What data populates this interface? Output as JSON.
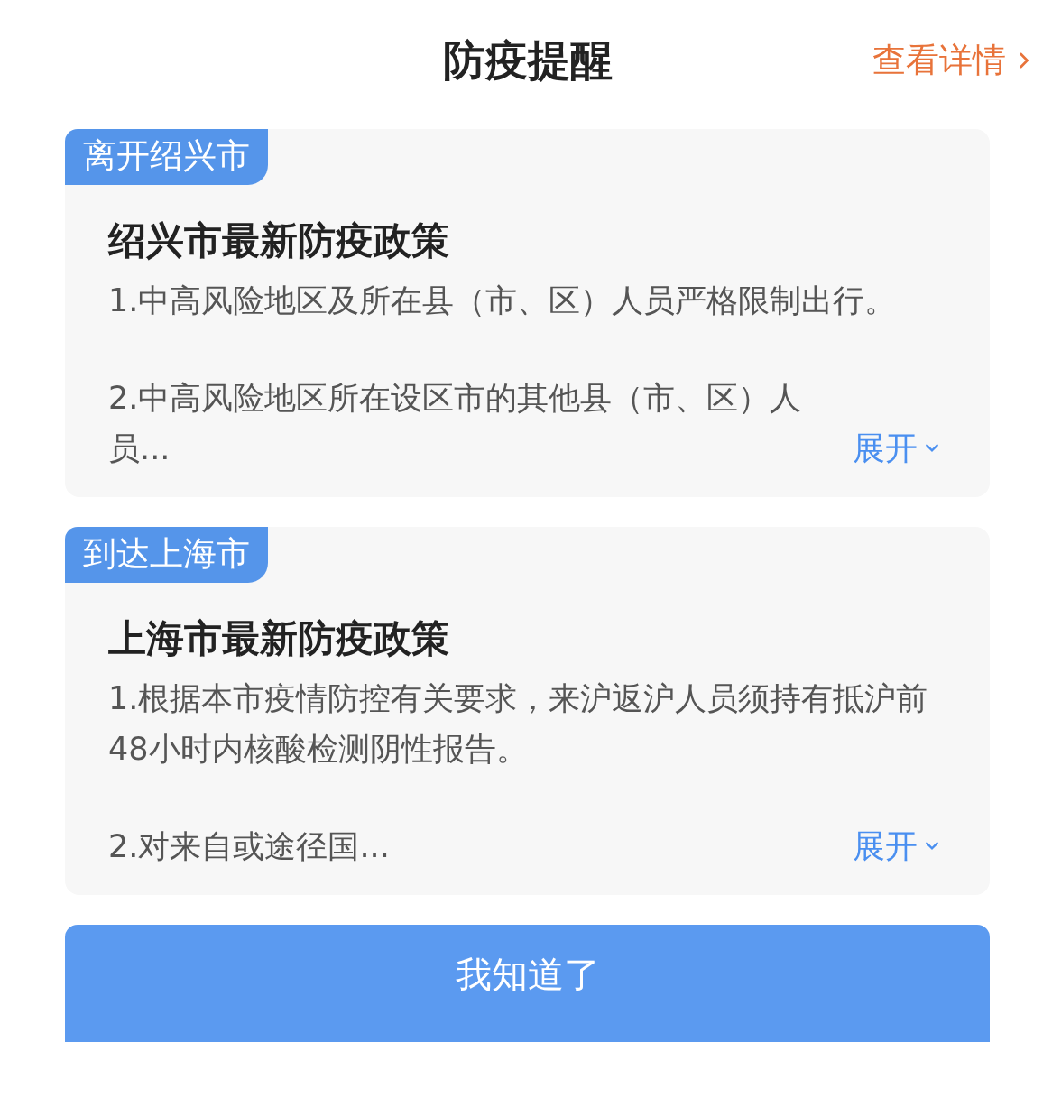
{
  "header": {
    "title": "防疫提醒",
    "details_link": "查看详情"
  },
  "cards": [
    {
      "tag": "离开绍兴市",
      "title": "绍兴市最新防疫政策",
      "paragraphs": [
        "1.中高风险地区及所在县（市、区）人员严格限制出行。",
        "2.中高风险地区所在设区市的其他县（市、区）人员..."
      ],
      "expand": "展开"
    },
    {
      "tag": "到达上海市",
      "title": "上海市最新防疫政策",
      "paragraphs": [
        "1.根据本市疫情防控有关要求，来沪返沪人员须持有抵沪前48小时内核酸检测阴性报告。",
        "2.对来自或途径国..."
      ],
      "expand": "展开"
    }
  ],
  "confirm_button": "我知道了"
}
